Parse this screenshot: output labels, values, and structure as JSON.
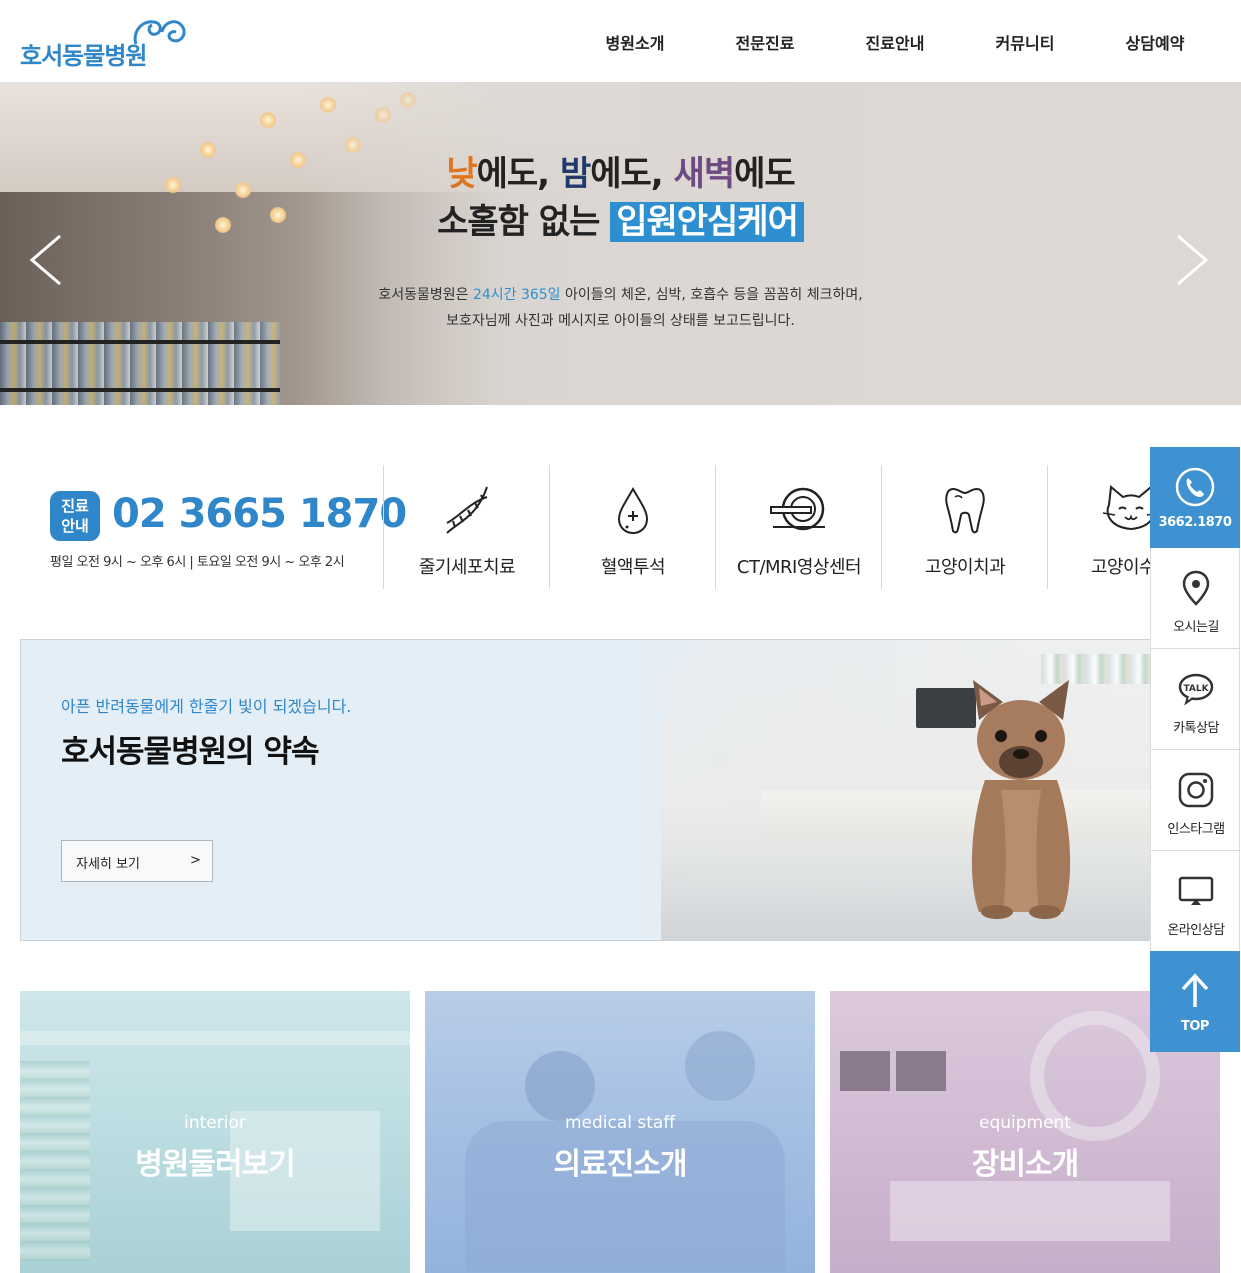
{
  "header": {
    "logo_text": "호서동물병원",
    "nav": [
      "병원소개",
      "전문진료",
      "진료안내",
      "커뮤니티",
      "상담예약"
    ]
  },
  "hero": {
    "line1": {
      "w1": "낮",
      "p1": "에도, ",
      "w2": "밤",
      "p2": "에도, ",
      "w3": "새벽",
      "p3": "에도"
    },
    "line2": {
      "pre": "소홀함 없는 ",
      "highlight": "입원안심케어"
    },
    "desc1": {
      "pre": "호서동물병원은 ",
      "highlight": "24시간 365일",
      "post": " 아이들의 체온, 심박, 호흡수 등을 꼼꼼히 체크하며,"
    },
    "desc2": "보호자님께 사진과 메시지로 아이들의 상태를 보고드립니다."
  },
  "info": {
    "badge": "진료\n안내",
    "badge_l1": "진료",
    "badge_l2": "안내",
    "phone": "02 3665 1870",
    "hours": "평일 오전 9시 ~ 오후 6시 | 토요일 오전 9시 ~ 오후 2시",
    "services": [
      {
        "label": "줄기세포치료",
        "icon": "dna-icon"
      },
      {
        "label": "혈액투석",
        "icon": "blood-drop-icon"
      },
      {
        "label": "CT/MRI영상센터",
        "icon": "ct-scanner-icon"
      },
      {
        "label": "고양이치과",
        "icon": "tooth-icon"
      },
      {
        "label": "고양이수술",
        "icon": "cat-icon"
      }
    ]
  },
  "promise": {
    "subtitle": "아픈 반려동물에게 한줄기 빛이 되겠습니다.",
    "title": "호서동물병원의 약속",
    "button": "자세히 보기",
    "button_arrow": ">"
  },
  "cards": [
    {
      "en": "interior",
      "ko": "병원둘러보기"
    },
    {
      "en": "medical staff",
      "ko": "의료진소개"
    },
    {
      "en": "equipment",
      "ko": "장비소개"
    }
  ],
  "quick": {
    "phone": "3662.1870",
    "items": [
      "오시는길",
      "카톡상담",
      "인스타그램",
      "온라인상담"
    ],
    "top": "TOP"
  },
  "colors": {
    "brand_blue": "#2f86c8",
    "quick_blue": "#3f92d2",
    "orange": "#e0751f",
    "navy": "#1f3a6b",
    "purple": "#6d4a83"
  }
}
